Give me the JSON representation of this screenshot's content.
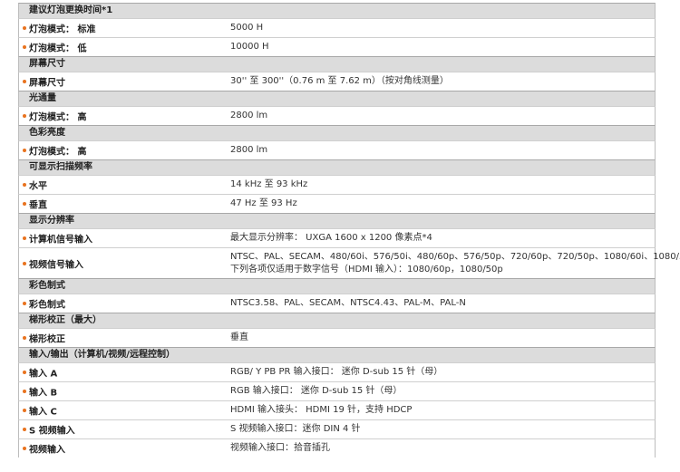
{
  "sections": [
    {
      "title": "建议灯泡更换时间*1",
      "rows": [
        {
          "label": "灯泡模式： 标准",
          "value": [
            "5000 H"
          ]
        },
        {
          "label": "灯泡模式： 低",
          "value": [
            "10000 H"
          ]
        }
      ]
    },
    {
      "title": "屏幕尺寸",
      "rows": [
        {
          "label": "屏幕尺寸",
          "value": [
            "30'' 至 300''（0.76 m 至 7.62 m）（按对角线测量）"
          ]
        }
      ]
    },
    {
      "title": "光通量",
      "rows": [
        {
          "label": "灯泡模式： 高",
          "value": [
            "2800 lm"
          ]
        }
      ]
    },
    {
      "title": "色彩亮度",
      "rows": [
        {
          "label": "灯泡模式： 高",
          "value": [
            "2800 lm"
          ]
        }
      ]
    },
    {
      "title": "可显示扫描频率",
      "rows": [
        {
          "label": "水平",
          "value": [
            "14 kHz 至 93 kHz"
          ]
        },
        {
          "label": "垂直",
          "value": [
            "47 Hz 至 93 Hz"
          ]
        }
      ]
    },
    {
      "title": "显示分辨率",
      "rows": [
        {
          "label": "计算机信号输入",
          "value": [
            "最大显示分辨率： UXGA 1600 x 1200 像素点*4"
          ]
        },
        {
          "label": "视频信号输入",
          "value": [
            "NTSC、PAL、SECAM、480/60i、576/50i、480/60p、576/50p、720/60p、720/50p、1080/60i、1080/50i，",
            "下列各项仅适用于数字信号（HDMI 输入）：1080/60p，1080/50p"
          ]
        }
      ]
    },
    {
      "title": "彩色制式",
      "rows": [
        {
          "label": "彩色制式",
          "value": [
            "NTSC3.58、PAL、SECAM、NTSC4.43、PAL-M、PAL-N"
          ]
        }
      ]
    },
    {
      "title": "梯形校正（最大）",
      "rows": [
        {
          "label": "梯形校正",
          "value": [
            "垂直"
          ]
        }
      ]
    },
    {
      "title": "输入/输出（计算机/视频/远程控制）",
      "rows": [
        {
          "label": "输入 A",
          "value": [
            "RGB/ Y PB PR 输入接口： 迷你 D-sub 15 针（母）"
          ]
        },
        {
          "label": "输入 B",
          "value": [
            "RGB 输入接口： 迷你 D-sub 15 针（母）"
          ]
        },
        {
          "label": "输入 C",
          "value": [
            "HDMI 输入接头： HDMI 19 针，支持 HDCP"
          ]
        },
        {
          "label": "S 视频输入",
          "value": [
            "S 视频输入接口：迷你 DIN 4 针"
          ]
        },
        {
          "label": "视频输入",
          "value": [
            "视频输入接口：拾音插孔"
          ]
        }
      ]
    }
  ]
}
